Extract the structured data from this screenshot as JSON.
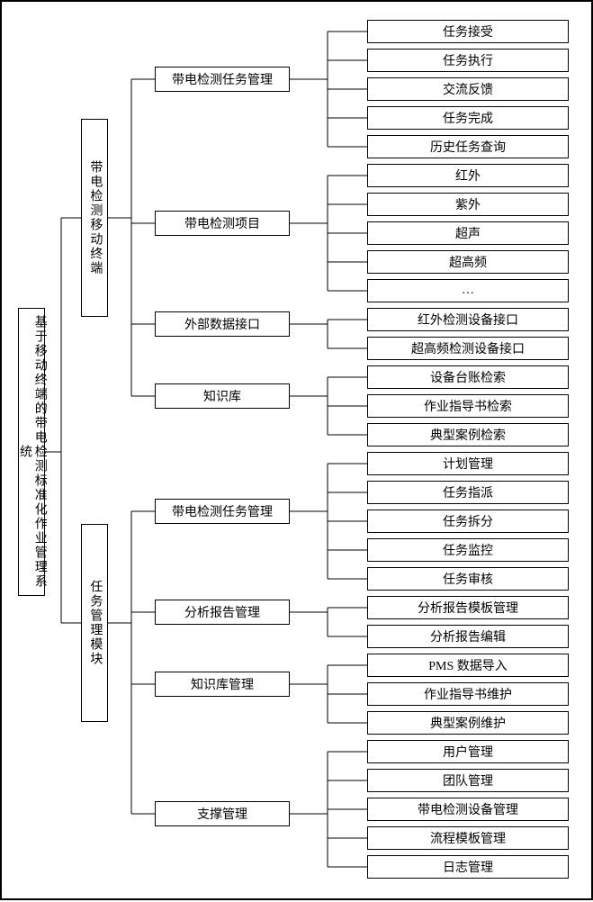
{
  "root": "基于移动终端的带电检测标准化作业管理系统",
  "lvl1": {
    "a": "带电检测移动终端",
    "b": "任务管理模块"
  },
  "lvl2": {
    "a1": "带电检测任务管理",
    "a2": "带电检测项目",
    "a3": "外部数据接口",
    "a4": "知识库",
    "b1": "带电检测任务管理",
    "b2": "分析报告管理",
    "b3": "知识库管理",
    "b4": "支撑管理"
  },
  "lvl3": {
    "a1_1": "任务接受",
    "a1_2": "任务执行",
    "a1_3": "交流反馈",
    "a1_4": "任务完成",
    "a1_5": "历史任务查询",
    "a2_1": "红外",
    "a2_2": "紫外",
    "a2_3": "超声",
    "a2_4": "超高频",
    "a2_5": "…",
    "a3_1": "红外检测设备接口",
    "a3_2": "超高频检测设备接口",
    "a4_1": "设备台账检索",
    "a4_2": "作业指导书检索",
    "a4_3": "典型案例检索",
    "b1_1": "计划管理",
    "b1_2": "任务指派",
    "b1_3": "任务拆分",
    "b1_4": "任务监控",
    "b1_5": "任务审核",
    "b2_1": "分析报告模板管理",
    "b2_2": "分析报告编辑",
    "b3_1": "PMS 数据导入",
    "b3_2": "作业指导书维护",
    "b3_3": "典型案例维护",
    "b4_1": "用户管理",
    "b4_2": "团队管理",
    "b4_3": "带电检测设备管理",
    "b4_4": "流程模板管理",
    "b4_5": "日志管理"
  },
  "chart_data": {
    "type": "tree",
    "root": "基于移动终端的带电检测标准化作业管理系统",
    "children": [
      {
        "name": "带电检测移动终端",
        "children": [
          {
            "name": "带电检测任务管理",
            "children": [
              "任务接受",
              "任务执行",
              "交流反馈",
              "任务完成",
              "历史任务查询"
            ]
          },
          {
            "name": "带电检测项目",
            "children": [
              "红外",
              "紫外",
              "超声",
              "超高频",
              "…"
            ]
          },
          {
            "name": "外部数据接口",
            "children": [
              "红外检测设备接口",
              "超高频检测设备接口"
            ]
          },
          {
            "name": "知识库",
            "children": [
              "设备台账检索",
              "作业指导书检索",
              "典型案例检索"
            ]
          }
        ]
      },
      {
        "name": "任务管理模块",
        "children": [
          {
            "name": "带电检测任务管理",
            "children": [
              "计划管理",
              "任务指派",
              "任务拆分",
              "任务监控",
              "任务审核"
            ]
          },
          {
            "name": "分析报告管理",
            "children": [
              "分析报告模板管理",
              "分析报告编辑"
            ]
          },
          {
            "name": "知识库管理",
            "children": [
              "PMS 数据导入",
              "作业指导书维护",
              "典型案例维护"
            ]
          },
          {
            "name": "支撑管理",
            "children": [
              "用户管理",
              "团队管理",
              "带电检测设备管理",
              "流程模板管理",
              "日志管理"
            ]
          }
        ]
      }
    ]
  }
}
